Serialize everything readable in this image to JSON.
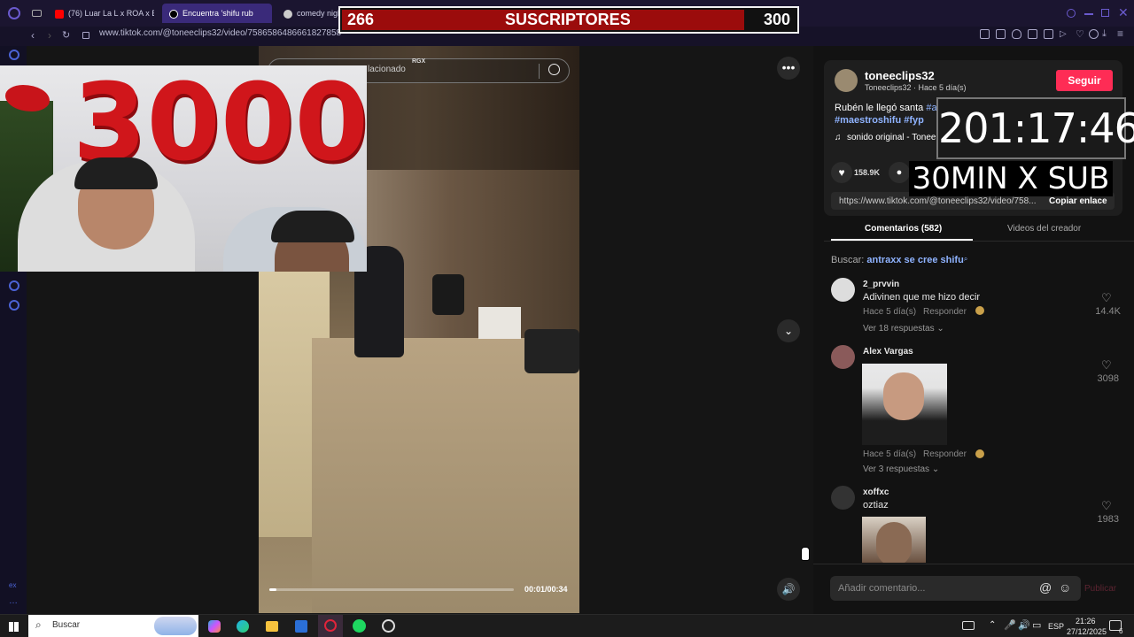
{
  "browser": {
    "tabs": [
      {
        "label": "(76) Luar La L x ROA x Bl",
        "color": "#ff0000",
        "active": false
      },
      {
        "label": "Encuentra 'shifu rub",
        "color": "#ffffff",
        "active": true
      },
      {
        "label": "comedy nigh",
        "color": "#d0d0d0",
        "active": false
      }
    ],
    "url": "www.tiktok.com/@toneeclips32/video/7586586486661827858"
  },
  "subscriber_bar": {
    "current": "266",
    "label": "SUSCRIPTORES",
    "goal": "300",
    "progress": 0.887
  },
  "webcam": {
    "balloons": "3000"
  },
  "video": {
    "search_placeholder_partial": "lacionado",
    "watermark": "RGX",
    "time": "00:01/00:34",
    "progress": 0.03
  },
  "post": {
    "username": "toneeclips32",
    "subline": "Toneeclips32 · Hace 5 día(s)",
    "follow_label": "Seguir",
    "caption_line1": "Rubén le llegó santa",
    "caption_hash_partial": "#a",
    "caption_line2_tags": "#maestroshifu #fyp",
    "sound": "sonido original - Tonee",
    "likes": "158.9K",
    "link": "https://www.tiktok.com/@toneeclips32/video/758...",
    "copy_link_label": "Copiar enlace"
  },
  "tabs": {
    "comments": "Comentarios (582)",
    "creator_videos": "Videos del creador"
  },
  "search_suggestion": {
    "prefix": "Buscar:",
    "query": "antraxx se cree shifu"
  },
  "comments": [
    {
      "name": "2_prvvin",
      "text": "Adivinen que me hizo decir",
      "meta": "Hace 5 día(s)",
      "reply": "Responder",
      "replies": "Ver 18 respuestas",
      "likes": "14.4K"
    },
    {
      "name": "Alex Vargas",
      "text": "",
      "meta": "Hace 5 día(s)",
      "reply": "Responder",
      "replies": "Ver 3 respuestas",
      "likes": "3098"
    },
    {
      "name": "xoffxc",
      "text": "oztiaz",
      "meta": "",
      "reply": "",
      "replies": "",
      "likes": "1983"
    }
  ],
  "comment_input": {
    "placeholder": "Añadir comentario...",
    "publish": "Publicar"
  },
  "overlays": {
    "timer": "201:17:46",
    "rule": "30MIN X SUB"
  },
  "taskbar": {
    "search": "Buscar",
    "lang": "ESP",
    "time": "21:26",
    "date": "27/12/2025",
    "notif": "6"
  },
  "colors": {
    "follow": "#fe2c55",
    "link": "#8fb3ff",
    "accent": "#5b3fd6"
  }
}
